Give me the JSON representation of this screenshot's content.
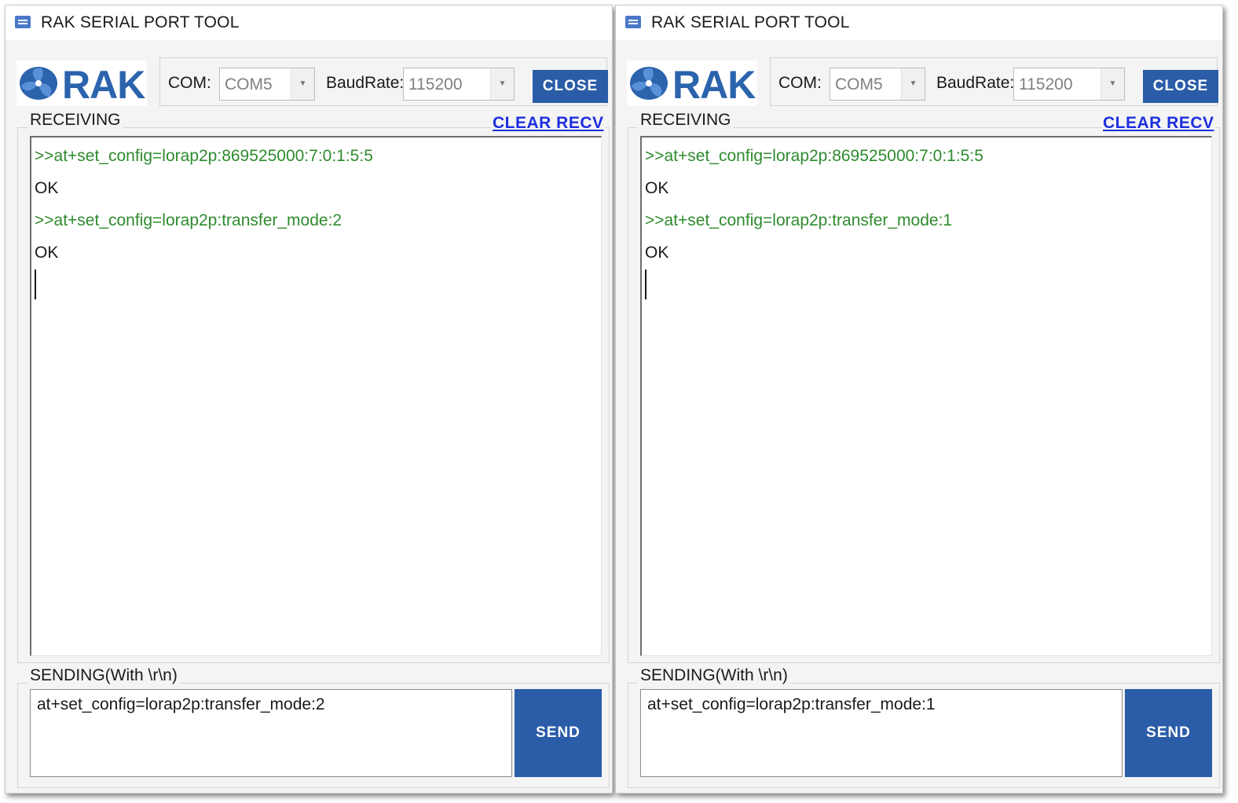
{
  "windows": [
    {
      "title": "RAK SERIAL PORT TOOL",
      "logo_text": "RAK",
      "com_label": "COM:",
      "com_value": "COM5",
      "baud_label": "BaudRate:",
      "baud_value": "115200",
      "close_label": "CLOSE",
      "receiving_label": "RECEIVING",
      "clear_recv_label": "CLEAR RECV",
      "recv_lines": [
        {
          "text": ">>at+set_config=lorap2p:869525000:7:0:1:5:5",
          "kind": "cmd"
        },
        {
          "text": "OK",
          "kind": "resp"
        },
        {
          "text": ">>at+set_config=lorap2p:transfer_mode:2",
          "kind": "cmd"
        },
        {
          "text": "OK",
          "kind": "resp"
        }
      ],
      "sending_label": "SENDING(With \\r\\n)",
      "send_value": "at+set_config=lorap2p:transfer_mode:2",
      "send_label": "SEND"
    },
    {
      "title": "RAK SERIAL PORT TOOL",
      "logo_text": "RAK",
      "com_label": "COM:",
      "com_value": "COM5",
      "baud_label": "BaudRate:",
      "baud_value": "115200",
      "close_label": "CLOSE",
      "receiving_label": "RECEIVING",
      "clear_recv_label": "CLEAR RECV",
      "recv_lines": [
        {
          "text": ">>at+set_config=lorap2p:869525000:7:0:1:5:5",
          "kind": "cmd"
        },
        {
          "text": "OK",
          "kind": "resp"
        },
        {
          "text": ">>at+set_config=lorap2p:transfer_mode:1",
          "kind": "cmd"
        },
        {
          "text": "OK",
          "kind": "resp"
        }
      ],
      "sending_label": "SENDING(With \\r\\n)",
      "send_value": "at+set_config=lorap2p:transfer_mode:1",
      "send_label": "SEND"
    }
  ],
  "colors": {
    "accent": "#2b5ca8",
    "link": "#1d2fe0",
    "command_text": "#2e8b2e"
  }
}
